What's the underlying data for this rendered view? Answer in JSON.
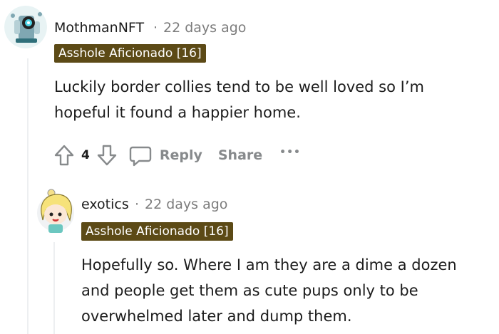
{
  "comment1": {
    "username": "MothmanNFT",
    "separator": "·",
    "timestamp": "22 days ago",
    "flair": "Asshole Aficionado [16]",
    "body_line1": "Luckily border collies tend to be well loved so I’m",
    "body_line2": "hopeful it found a happier home.",
    "score": "4",
    "reply_label": "Reply",
    "share_label": "Share",
    "more_label": "•••"
  },
  "comment2": {
    "username": "exotics",
    "separator": "·",
    "timestamp": "22 days ago",
    "flair": "Asshole Aficionado [16]",
    "body_line1": "Hopefully so. Where I am they are a dime a dozen",
    "body_line2": "and people get them as cute pups only to be",
    "body_line3": "overwhelmed later and dump them."
  },
  "colors": {
    "flair_bg": "#5c4a16",
    "meta_text": "#7c7c7c",
    "action_text": "#878a8c"
  }
}
